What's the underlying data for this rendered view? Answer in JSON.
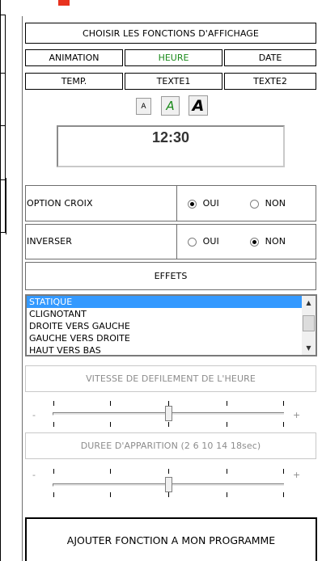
{
  "header": {
    "title": "CHOISIR LES FONCTIONS D'AFFICHAGE"
  },
  "tabs": [
    {
      "label": "ANIMATION",
      "color": "#000000"
    },
    {
      "label": "HEURE",
      "color": "#1a8a1a"
    },
    {
      "label": "DATE",
      "color": "#000000"
    },
    {
      "label": "TEMP.",
      "color": "#000000"
    },
    {
      "label": "TEXTE1",
      "color": "#000000"
    },
    {
      "label": "TEXTE2",
      "color": "#000000"
    }
  ],
  "font_size_buttons": [
    {
      "label": "A",
      "size": "small"
    },
    {
      "label": "A",
      "size": "medium"
    },
    {
      "label": "A",
      "size": "large"
    }
  ],
  "display": {
    "value": "12:30"
  },
  "options": {
    "croix": {
      "label": "OPTION CROIX",
      "oui": "OUI",
      "non": "NON",
      "selected": "OUI"
    },
    "inverser": {
      "label": "INVERSER",
      "oui": "OUI",
      "non": "NON",
      "selected": "NON"
    }
  },
  "effets": {
    "title": "EFFETS",
    "items": [
      "STATIQUE",
      "CLIGNOTANT",
      "DROITE VERS GAUCHE",
      "GAUCHE VERS DROITE",
      "HAUT VERS BAS"
    ],
    "selected": "STATIQUE"
  },
  "speed": {
    "label": "VITESSE DE DEFILEMENT DE L'HEURE",
    "min_label": "-",
    "max_label": "+",
    "value_fraction": 0.5
  },
  "duration": {
    "label": "DUREE D'APPARITION (2 6 10 14 18sec)",
    "min_label": "-",
    "max_label": "+",
    "value_fraction": 0.5
  },
  "actions": {
    "add": "AJOUTER FONCTION A MON PROGRAMME"
  },
  "colors": {
    "accent_red": "#e8321e",
    "selection_blue": "#3399ff",
    "heure_green": "#1a8a1a"
  }
}
